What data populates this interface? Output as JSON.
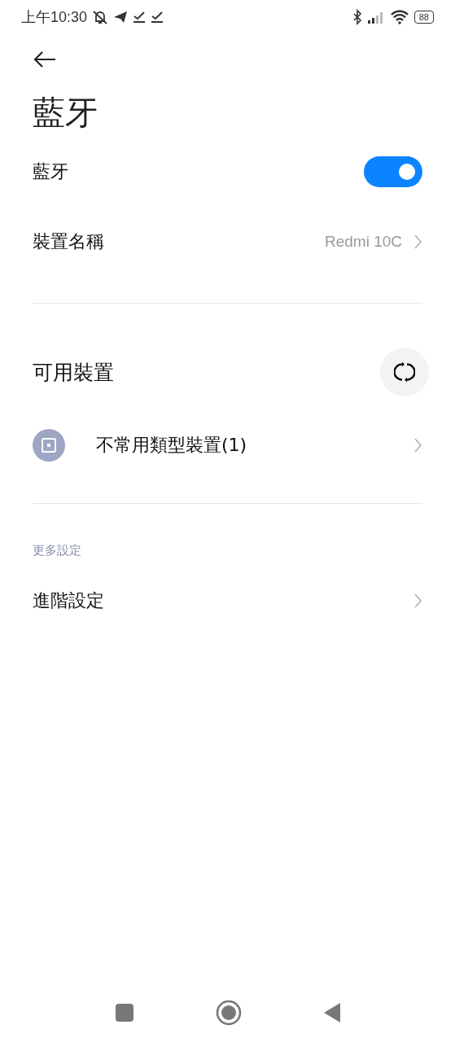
{
  "status_bar": {
    "time": "上午10:30",
    "battery": "88"
  },
  "title": "藍牙",
  "bluetooth_toggle": {
    "label": "藍牙",
    "on": true
  },
  "device_name": {
    "label": "裝置名稱",
    "value": "Redmi 10C"
  },
  "available_devices": {
    "title": "可用裝置",
    "groups": [
      {
        "label": "不常用類型裝置(1)"
      }
    ]
  },
  "more_settings": {
    "header": "更多設定",
    "items": [
      {
        "label": "進階設定"
      }
    ]
  }
}
